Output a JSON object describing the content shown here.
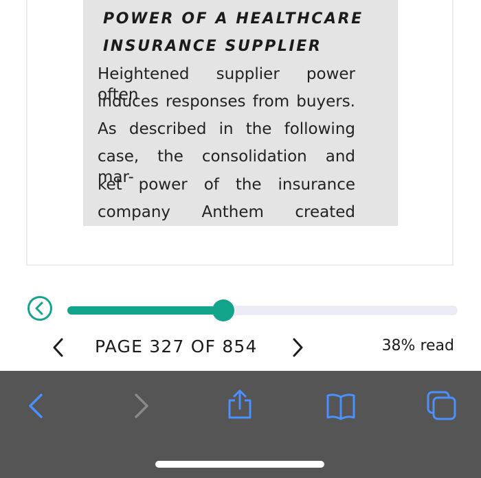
{
  "book": {
    "heading_line1": "POWER OF A HEALTHCARE",
    "heading_line2": "INSURANCE SUPPLIER",
    "body_lines": [
      "Heightened supplier power often",
      "induces responses from buyers.",
      "As described in the following",
      "case, the consolidation and mar-",
      "ket power of the insurance",
      "company Anthem created"
    ]
  },
  "progress": {
    "page_label": "PAGE 327 OF 854",
    "read_label": "38% read",
    "fraction": 0.4
  },
  "icons": {
    "back": "back-circle-icon",
    "prev_page": "chevron-left-icon",
    "next_page": "chevron-right-icon",
    "browser_back": "chevron-left-icon",
    "browser_forward": "chevron-right-icon",
    "share": "share-icon",
    "bookmarks": "book-icon",
    "tabs": "tabs-icon"
  },
  "colors": {
    "accent": "#12a58c",
    "toolbar_blue": "#4a90ff",
    "toolbar_disabled": "#8a8a8a"
  }
}
